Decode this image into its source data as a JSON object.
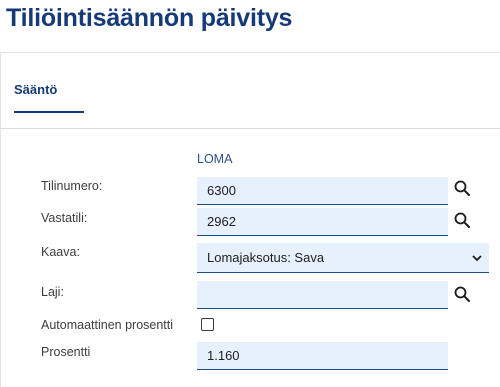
{
  "page": {
    "title": "Tiliöintisäännön päivitys"
  },
  "tabs": [
    {
      "label": "Sääntö",
      "active": true
    }
  ],
  "section": {
    "label": "LOMA"
  },
  "form": {
    "tilinumero": {
      "label": "Tilinumero:",
      "value": "6300"
    },
    "vastatili": {
      "label": "Vastatili:",
      "value": "2962"
    },
    "kaava": {
      "label": "Kaava:",
      "value": "Lomajaksotus: Sava"
    },
    "laji": {
      "label": "Laji:",
      "value": ""
    },
    "automaattinen": {
      "label": "Automaattinen prosentti",
      "checked": false
    },
    "prosentti": {
      "label": "Prosentti",
      "value": "1.160"
    }
  },
  "icons": {
    "search": "search-icon",
    "dropdown": "chevron-down-icon",
    "checkbox": "checkbox-icon"
  },
  "colors": {
    "accent": "#163a78",
    "field_bg": "#e7f1fd",
    "field_border": "#1f4c8c"
  }
}
